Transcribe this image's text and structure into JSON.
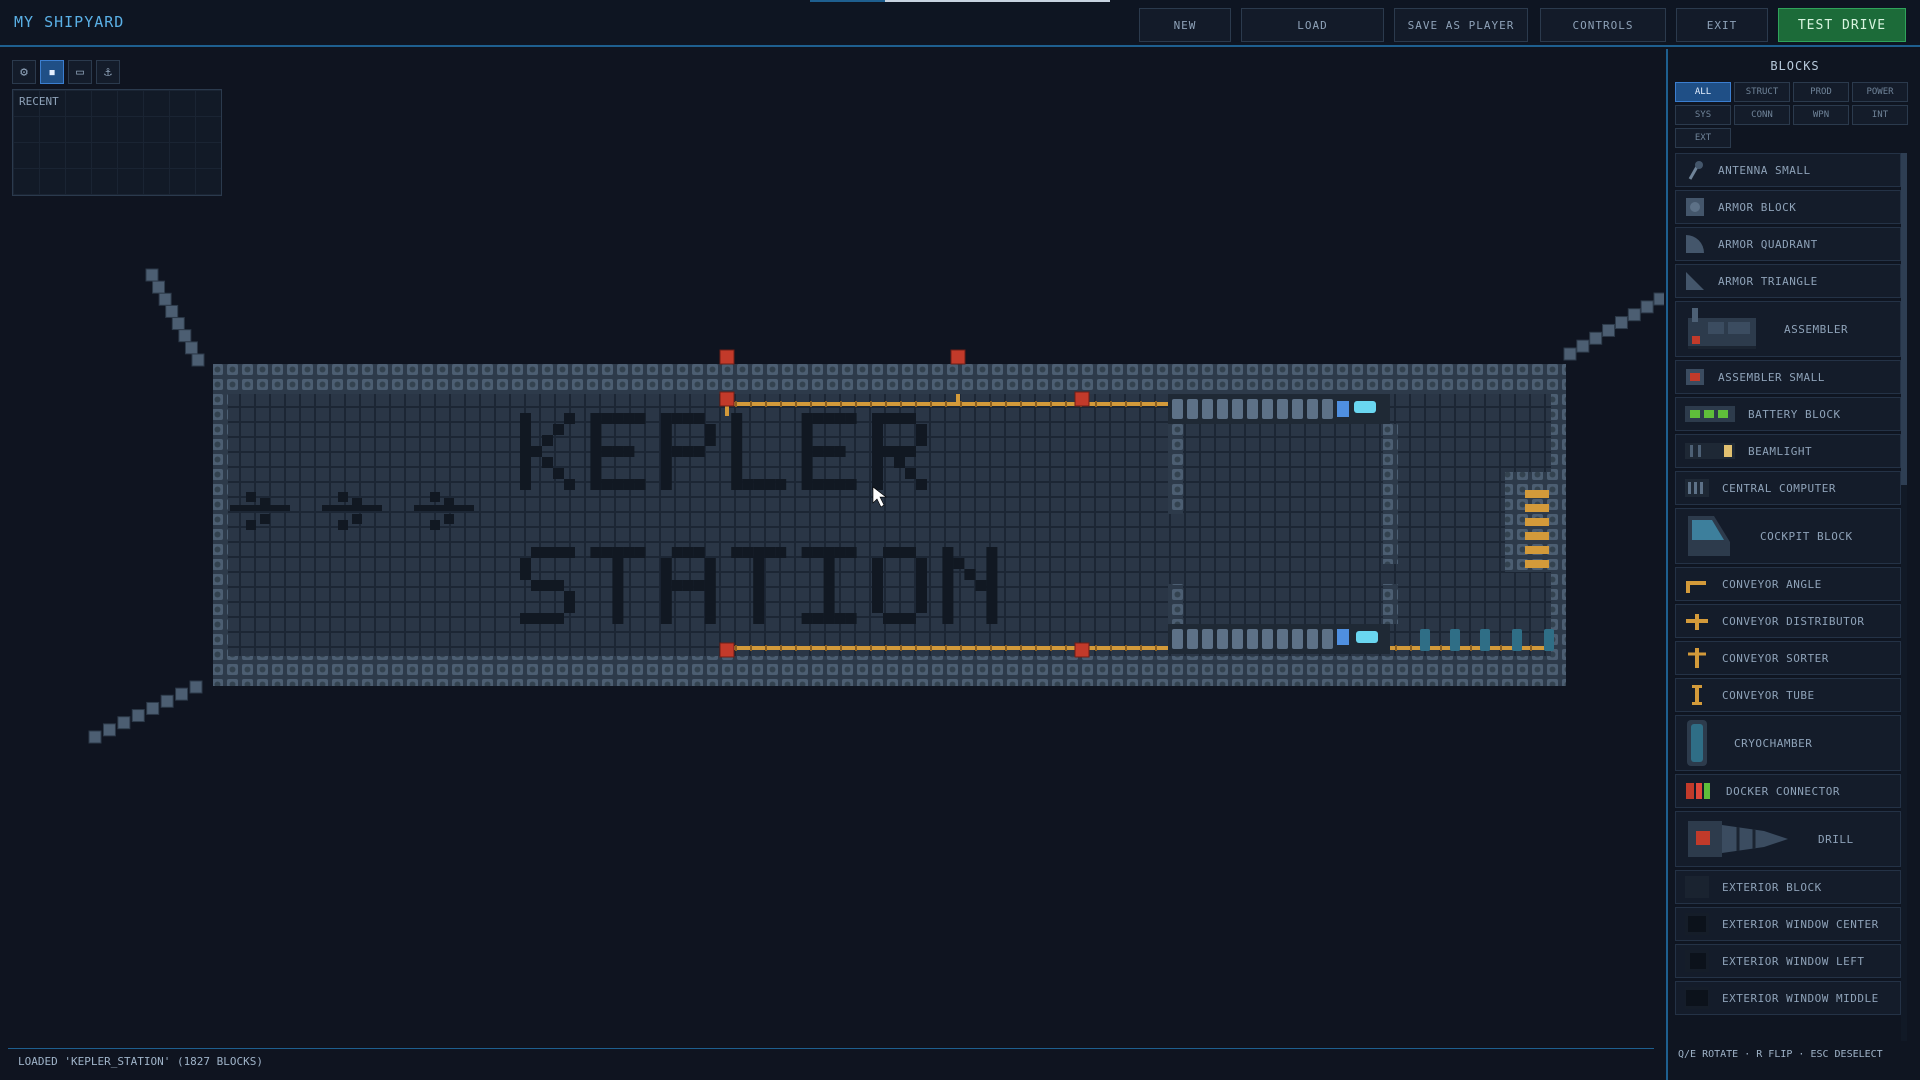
{
  "header": {
    "title": "MY SHIPYARD",
    "buttons": [
      {
        "id": "new",
        "label": "NEW"
      },
      {
        "id": "load",
        "label": "LOAD"
      },
      {
        "id": "save",
        "label": "SAVE AS PLAYER"
      },
      {
        "id": "controls",
        "label": "CONTROLS"
      },
      {
        "id": "exit",
        "label": "EXIT"
      },
      {
        "id": "test",
        "label": "TEST DRIVE"
      }
    ]
  },
  "tools": {
    "icons": [
      "gear-icon",
      "pencil-icon",
      "box-select-icon",
      "anchor-icon"
    ],
    "active_index": 1,
    "recent_label": "RECENT"
  },
  "sidebar": {
    "title": "BLOCKS",
    "filters": [
      "ALL",
      "STRUCT",
      "PROD",
      "POWER",
      "SYS",
      "CONN",
      "WPN",
      "INT",
      "EXT"
    ],
    "active_filter": "ALL",
    "items": [
      {
        "label": "ANTENNA SMALL",
        "icon": "antenna-icon",
        "size": "small"
      },
      {
        "label": "ARMOR BLOCK",
        "icon": "armor-block-icon",
        "size": "small"
      },
      {
        "label": "ARMOR QUADRANT",
        "icon": "armor-quadrant-icon",
        "size": "small"
      },
      {
        "label": "ARMOR TRIANGLE",
        "icon": "armor-triangle-icon",
        "size": "small"
      },
      {
        "label": "ASSEMBLER",
        "icon": "assembler-icon",
        "size": "large"
      },
      {
        "label": "ASSEMBLER SMALL",
        "icon": "assembler-small-icon",
        "size": "small"
      },
      {
        "label": "BATTERY BLOCK",
        "icon": "battery-icon",
        "size": "small"
      },
      {
        "label": "BEAMLIGHT",
        "icon": "beamlight-icon",
        "size": "small"
      },
      {
        "label": "CENTRAL COMPUTER",
        "icon": "computer-icon",
        "size": "small"
      },
      {
        "label": "COCKPIT BLOCK",
        "icon": "cockpit-icon",
        "size": "large"
      },
      {
        "label": "CONVEYOR ANGLE",
        "icon": "conveyor-angle-icon",
        "size": "small"
      },
      {
        "label": "CONVEYOR DISTRIBUTOR",
        "icon": "conveyor-distributor-icon",
        "size": "small"
      },
      {
        "label": "CONVEYOR SORTER",
        "icon": "conveyor-sorter-icon",
        "size": "small"
      },
      {
        "label": "CONVEYOR TUBE",
        "icon": "conveyor-tube-icon",
        "size": "small"
      },
      {
        "label": "CRYOCHAMBER",
        "icon": "cryochamber-icon",
        "size": "large"
      },
      {
        "label": "DOCKER CONNECTOR",
        "icon": "docker-connector-icon",
        "size": "small"
      },
      {
        "label": "DRILL",
        "icon": "drill-icon",
        "size": "large"
      },
      {
        "label": "EXTERIOR BLOCK",
        "icon": "exterior-block-icon",
        "size": "small"
      },
      {
        "label": "EXTERIOR WINDOW CENTER",
        "icon": "window-center-icon",
        "size": "small"
      },
      {
        "label": "EXTERIOR WINDOW LEFT",
        "icon": "window-left-icon",
        "size": "small"
      },
      {
        "label": "EXTERIOR WINDOW MIDDLE",
        "icon": "window-middle-icon",
        "size": "small"
      }
    ],
    "hint": "Q/E ROTATE · R FLIP · ESC DESELECT"
  },
  "canvas": {
    "station_text": [
      "KEPLER",
      "STATION"
    ]
  },
  "status": {
    "text": "LOADED 'KEPLER_STATION' (1827 BLOCKS)"
  },
  "colors": {
    "accent": "#1e5f8f",
    "primary_button": "#1c6b39",
    "conveyor": "#d39a3a",
    "hull": "#3a4a5c"
  }
}
